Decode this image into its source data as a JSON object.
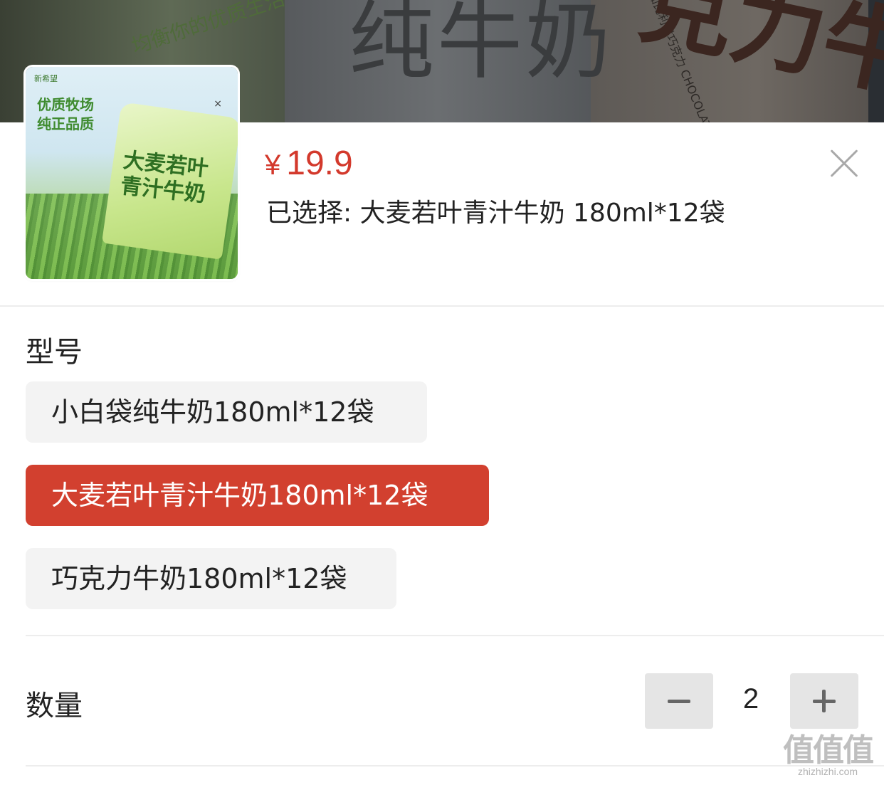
{
  "backdrop": {
    "text_center": "纯牛奶",
    "text_right": "克力牛奶",
    "text_left": "均衡你的优质生活",
    "text_chocolate": "添加比利时巧克力 CHOCOLATE"
  },
  "product": {
    "thumbnail": {
      "brand": "新希望",
      "slogan_line1": "优质牧场",
      "slogan_line2": "纯正品质",
      "pack_line1": "大麦若叶",
      "pack_line2": "青汁牛奶",
      "close_mark": "×"
    },
    "price_symbol": "¥",
    "price": "19.9",
    "selected_text": "已选择: 大麦若叶青汁牛奶 180ml*12袋"
  },
  "model_section": {
    "label": "型号",
    "options": [
      {
        "label": "小白袋纯牛奶180ml*12袋",
        "selected": false
      },
      {
        "label": "大麦若叶青汁牛奶180ml*12袋",
        "selected": true
      },
      {
        "label": "巧克力牛奶180ml*12袋",
        "selected": false
      }
    ]
  },
  "quantity_section": {
    "label": "数量",
    "value": "2"
  },
  "colors": {
    "accent": "#d2402f",
    "price": "#d3392c",
    "option_bg": "#f3f3f3"
  },
  "icons": {
    "close": "close-icon",
    "minus": "minus-icon",
    "plus": "plus-icon"
  },
  "watermark": {
    "main": "值值值",
    "url": "zhizhizhi.com"
  }
}
